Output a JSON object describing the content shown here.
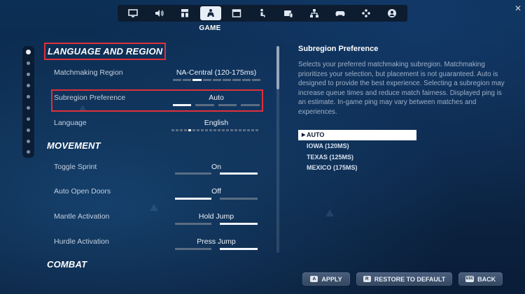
{
  "tabs": [
    {
      "icon": "monitor-icon",
      "active": false
    },
    {
      "icon": "speaker-icon",
      "active": false
    },
    {
      "icon": "ui-layout-icon",
      "active": false
    },
    {
      "icon": "game-controller-person-icon",
      "active": true
    },
    {
      "icon": "window-icon",
      "active": false
    },
    {
      "icon": "person-accessibility-icon",
      "active": false
    },
    {
      "icon": "input-device-icon",
      "active": false
    },
    {
      "icon": "network-icon",
      "active": false
    },
    {
      "icon": "gamepad-icon",
      "active": false
    },
    {
      "icon": "dpad-icon",
      "active": false
    },
    {
      "icon": "account-icon",
      "active": false
    }
  ],
  "active_tab_label": "GAME",
  "close_glyph": "✕",
  "sections": {
    "language_region": "LANGUAGE AND REGION",
    "movement": "MOVEMENT",
    "combat": "COMBAT"
  },
  "settings": {
    "matchmaking_region": {
      "label": "Matchmaking Region",
      "value": "NA-Central (120-175ms)"
    },
    "subregion_preference": {
      "label": "Subregion Preference",
      "value": "Auto"
    },
    "language": {
      "label": "Language",
      "value": "English"
    },
    "toggle_sprint": {
      "label": "Toggle Sprint",
      "value": "On"
    },
    "auto_open_doors": {
      "label": "Auto Open Doors",
      "value": "Off"
    },
    "mantle_activation": {
      "label": "Mantle Activation",
      "value": "Hold Jump"
    },
    "hurdle_activation": {
      "label": "Hurdle Activation",
      "value": "Press Jump"
    }
  },
  "detail_panel": {
    "title": "Subregion Preference",
    "description": "Selects your preferred matchmaking subregion. Matchmaking prioritizes your selection, but placement is not guaranteed. Auto is designed to provide the best experience. Selecting a subregion may increase queue times and reduce match fairness. Displayed ping is an estimate. In-game ping may vary between matches and experiences.",
    "options": [
      "AUTO",
      "IOWA (120MS)",
      "TEXAS (125MS)",
      "MEXICO (175MS)"
    ],
    "selected_index": 0,
    "selected_caret": "▶"
  },
  "buttons": {
    "apply": {
      "key": "A",
      "label": "APPLY"
    },
    "restore": {
      "key": "R",
      "label": "RESTORE TO DEFAULT"
    },
    "back": {
      "key": "ESC",
      "label": "BACK"
    }
  },
  "colors": {
    "highlight_box": "#e0303a",
    "selected_option_bg": "#ffffff",
    "segment_on": "#f2f6fb",
    "segment_off": "#5b6d84"
  }
}
